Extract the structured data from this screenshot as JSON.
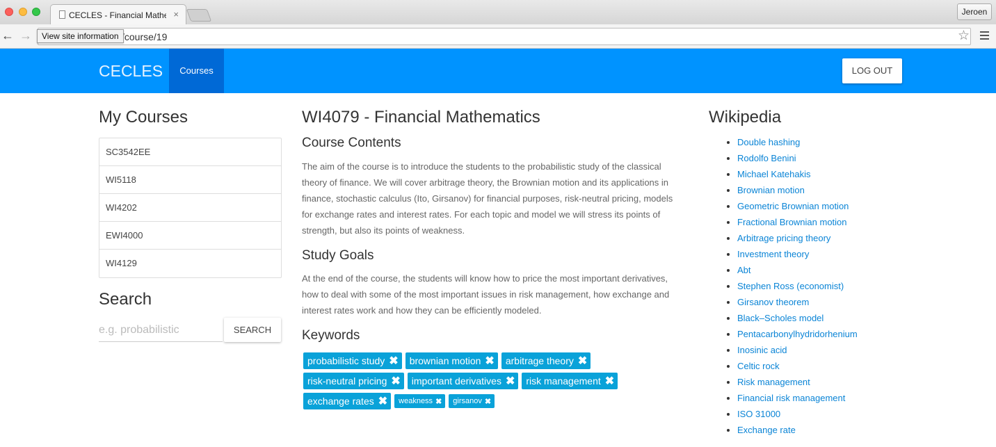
{
  "browser": {
    "tab_title": "CECLES - Financial Mathe",
    "tab_close": "×",
    "profile_name": "Jeroen",
    "url": "/course/19",
    "tooltip": "View site information",
    "back_glyph": "←",
    "forward_glyph": "→",
    "star_glyph": "☆"
  },
  "navbar": {
    "brand": "CECLES",
    "courses_link": "Courses",
    "logout_label": "LOG OUT",
    "color": "#0093ff",
    "active_color": "#0069d6"
  },
  "sidebar": {
    "title": "My Courses",
    "courses": [
      "SC3542EE",
      "WI5118",
      "WI4202",
      "EWI4000",
      "WI4129"
    ],
    "search_title": "Search",
    "search_placeholder": "e.g. probabilistic",
    "search_button": "SEARCH"
  },
  "course": {
    "title": "WI4079 - Financial Mathematics",
    "contents_heading": "Course Contents",
    "contents_text": "The aim of the course is to introduce the students to the probabilistic study of the classical theory of finance. We will cover arbitrage theory, the Brownian motion and its applications in finance, stochastic calculus (Ito, Girsanov) for financial purposes, risk-neutral pricing, models for exchange rates and interest rates. For each topic and model we will stress its points of strength, but also its points of weakness.",
    "goals_heading": "Study Goals",
    "goals_text": "At the end of the course, the students will know how to price the most important derivatives, how to deal with some of the most important issues in risk management, how exchange and interest rates work and how they can be efficiently modeled.",
    "keywords_heading": "Keywords",
    "remove_glyph": "✖",
    "keyword_rows": [
      [
        "probabilistic study",
        "brownian motion",
        "arbitrage theory"
      ],
      [
        "risk-neutral pricing",
        "important derivatives",
        "risk management"
      ],
      [
        "exchange rates"
      ]
    ],
    "small_keywords": [
      "weakness",
      "girsanov"
    ],
    "keyword_color": "#0aa2d9"
  },
  "wikipedia": {
    "title": "Wikipedia",
    "links": [
      "Double hashing",
      "Rodolfo Benini",
      "Michael Katehakis",
      "Brownian motion",
      "Geometric Brownian motion",
      "Fractional Brownian motion",
      "Arbitrage pricing theory",
      "Investment theory",
      "Abt",
      "Stephen Ross (economist)",
      "Girsanov theorem",
      "Black–Scholes model",
      "Pentacarbonylhydridorhenium",
      "Inosinic acid",
      "Celtic rock",
      "Risk management",
      "Financial risk management",
      "ISO 31000",
      "Exchange rate"
    ],
    "link_color": "#0a84d6"
  }
}
